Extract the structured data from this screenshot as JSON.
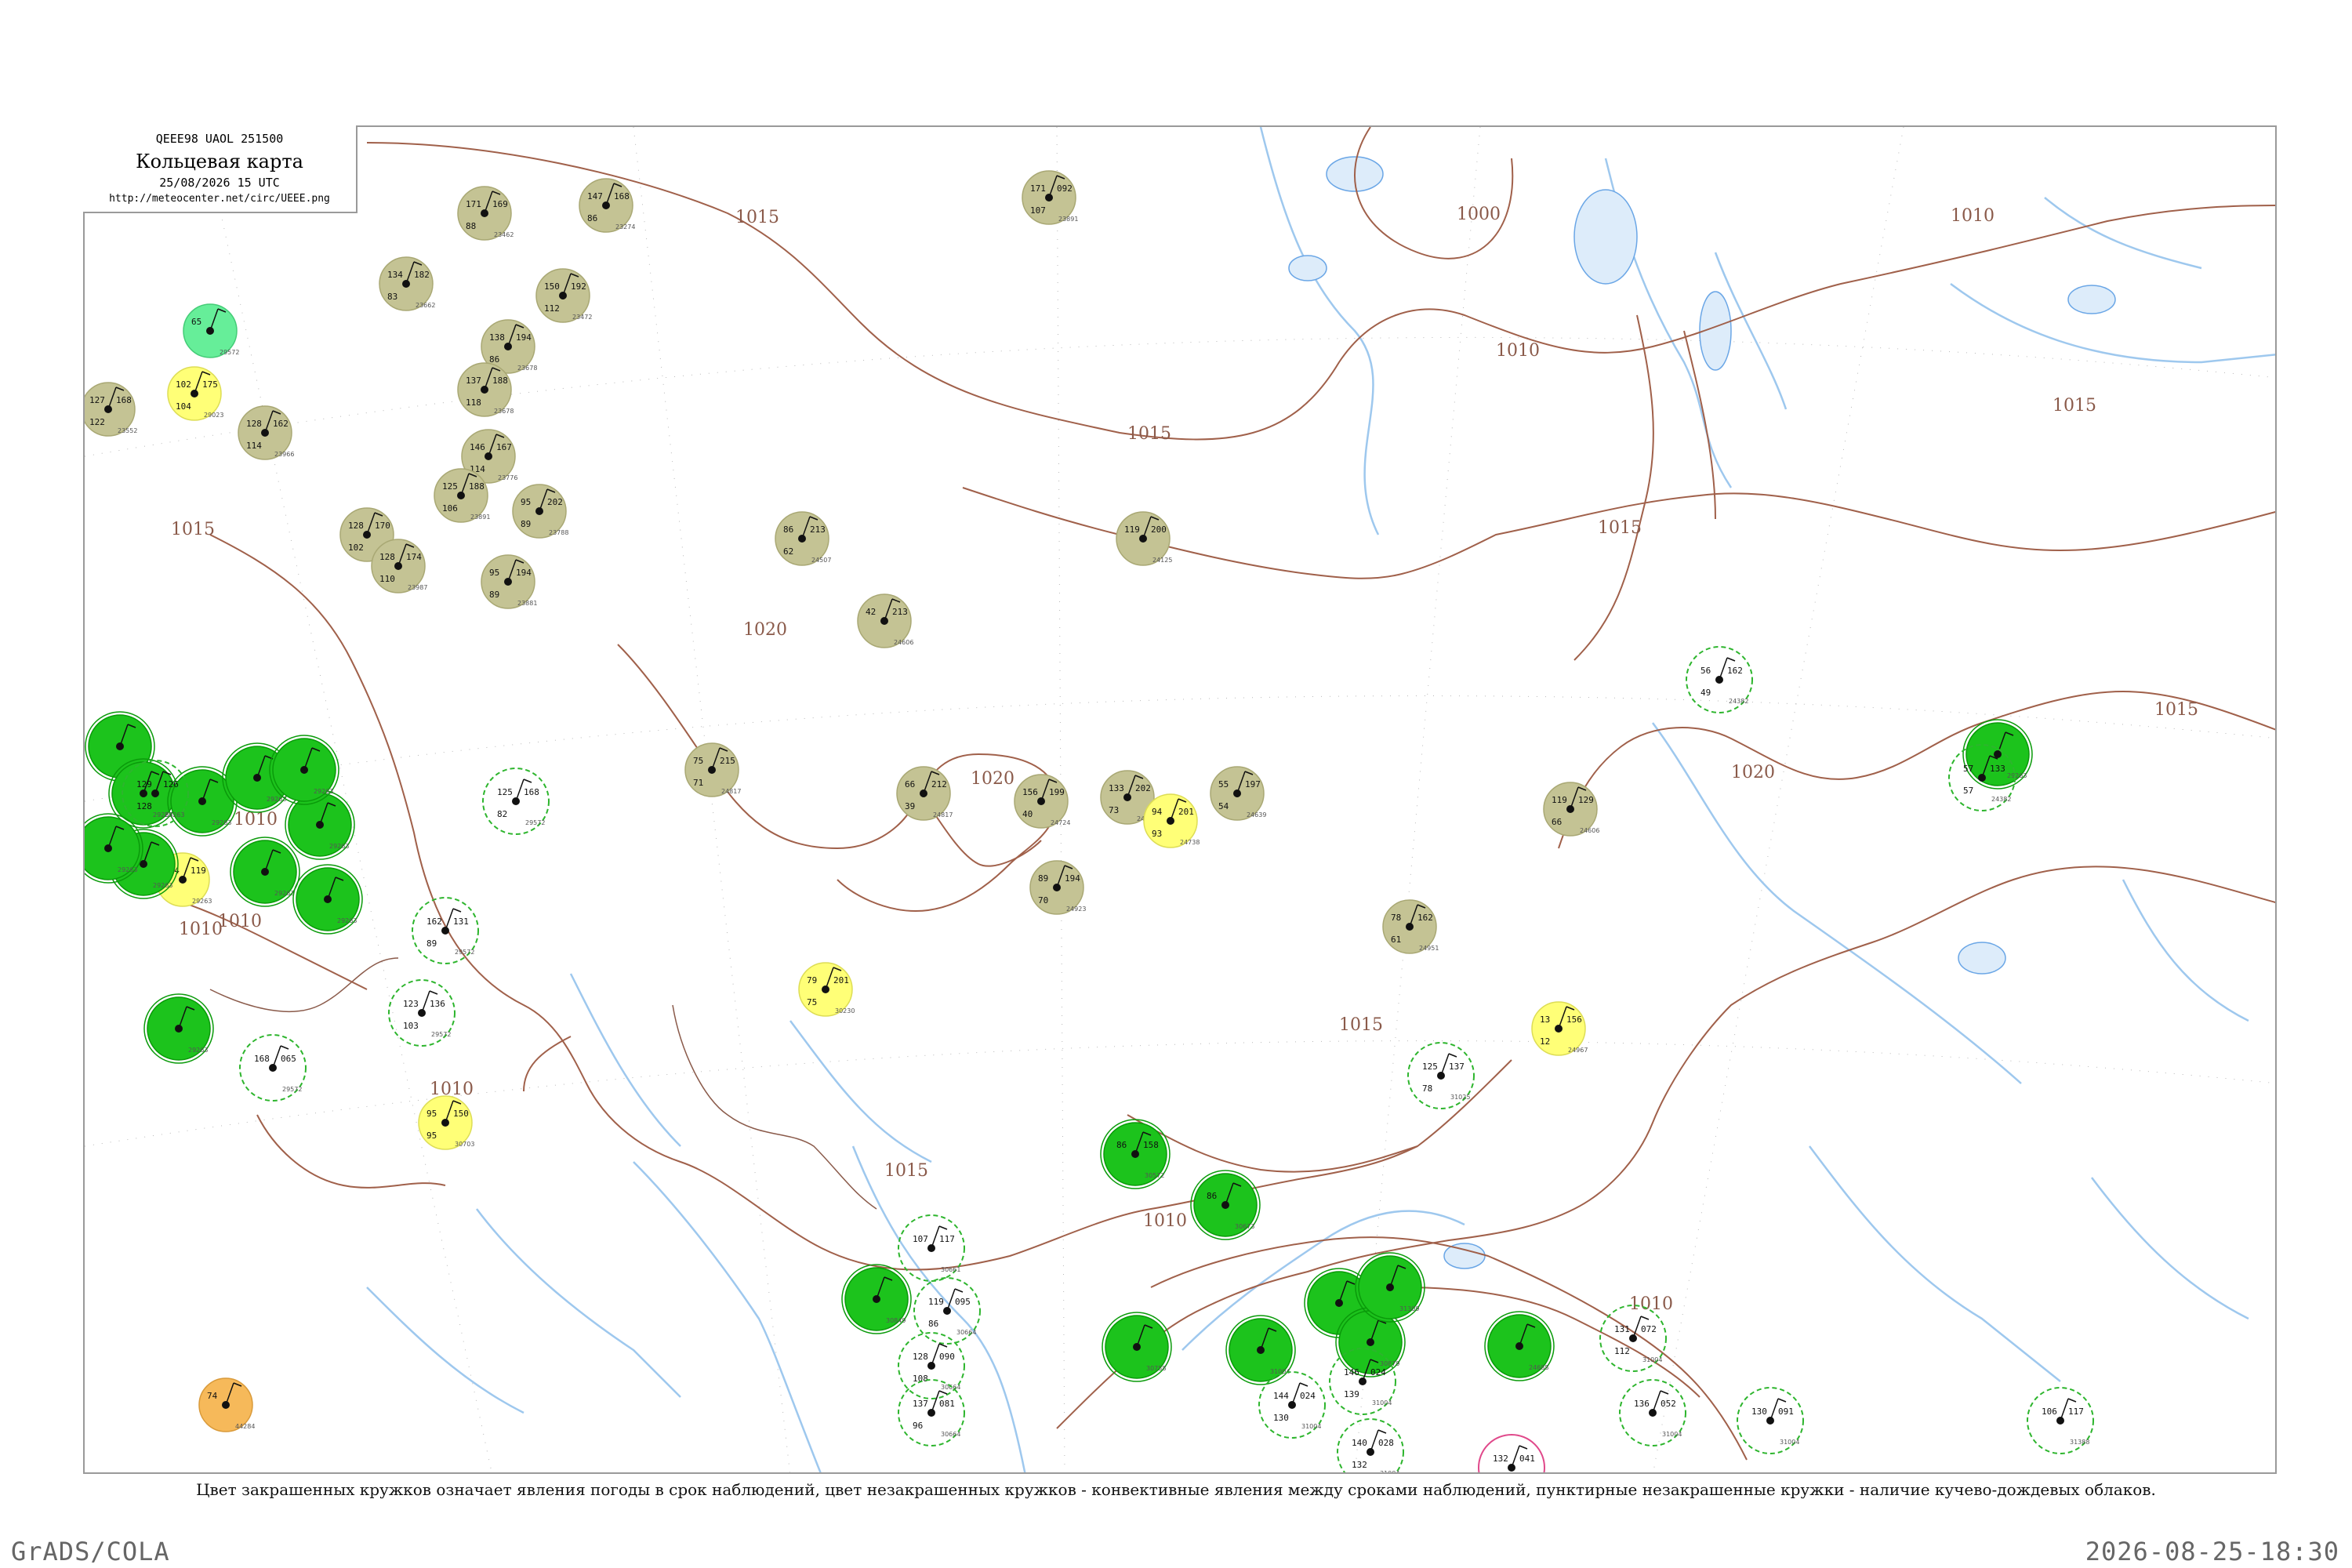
{
  "header": {
    "code_line": "QEEE98  UAOL  251500",
    "title": "Кольцевая карта",
    "datetime": "25/08/2026 15 UTC",
    "url": "http://meteocenter.net/circ/UEEE.png"
  },
  "caption": "Цвет закрашенных кружков означает явления погоды в срок наблюдений, цвет незакрашенных кружков - конвективные явления между сроками наблюдений, пунктирные незакрашенные кружки - наличие кучево-дождевых облаков.",
  "footer": {
    "left": "GrADS/COLA",
    "right": "2026-08-25-18:30"
  },
  "colors": {
    "isobar": "#a0604a",
    "river": "#9ec8ee",
    "lake": "#6aa6e6",
    "fill_olive": "#c4c394",
    "fill_green": "#1cc31c",
    "fill_yellow": "#ffff77",
    "fill_orange": "#f6b95a",
    "fill_mint": "#66ee99",
    "ring_dashed": "#2db52d",
    "ring_pink": "#e0488a"
  },
  "isobar_labels": [
    {
      "id": "iso-1000",
      "text": "1000"
    },
    {
      "id": "iso-1010-a",
      "text": "1010"
    },
    {
      "id": "iso-1010-b",
      "text": "1010"
    },
    {
      "id": "iso-1010-c",
      "text": "1010"
    },
    {
      "id": "iso-1010-d",
      "text": "1010"
    },
    {
      "id": "iso-1010-e",
      "text": "1010"
    },
    {
      "id": "iso-1010-f",
      "text": "1010"
    },
    {
      "id": "iso-1010-g",
      "text": "1010"
    },
    {
      "id": "iso-1010-h",
      "text": "1010"
    },
    {
      "id": "iso-1015-a",
      "text": "1015"
    },
    {
      "id": "iso-1015-b",
      "text": "1015"
    },
    {
      "id": "iso-1015-c",
      "text": "1015"
    },
    {
      "id": "iso-1015-d",
      "text": "1015"
    },
    {
      "id": "iso-1015-e",
      "text": "1015"
    },
    {
      "id": "iso-1015-f",
      "text": "1015"
    },
    {
      "id": "iso-1015-g",
      "text": "1015"
    },
    {
      "id": "iso-1015-h",
      "text": "1015"
    },
    {
      "id": "iso-1020-a",
      "text": "1020"
    },
    {
      "id": "iso-1020-b",
      "text": "1020"
    }
  ],
  "stations": [
    {
      "id": "st1",
      "temp": "171",
      "press": "169",
      "dew": "88",
      "style": "olive",
      "name": "23462"
    },
    {
      "id": "st2",
      "temp": "147",
      "press": "168",
      "dew": "86",
      "style": "olive",
      "name": "23274"
    },
    {
      "id": "st3",
      "temp": "134",
      "press": "182",
      "dew": "83",
      "style": "olive",
      "name": "23662"
    },
    {
      "id": "st4",
      "temp": "150",
      "press": "192",
      "dew": "112",
      "style": "olive",
      "name": "23472"
    },
    {
      "id": "st5",
      "temp": "138",
      "press": "194",
      "dew": "86",
      "style": "olive",
      "name": "23678"
    },
    {
      "id": "st6",
      "temp": "137",
      "press": "188",
      "dew": "118",
      "style": "olive",
      "name": "23678"
    },
    {
      "id": "st7",
      "temp": "146",
      "press": "167",
      "dew": "114",
      "style": "olive",
      "name": "23776"
    },
    {
      "id": "st8",
      "temp": "125",
      "press": "188",
      "dew": "106",
      "style": "olive",
      "name": "23891"
    },
    {
      "id": "st9",
      "temp": "95",
      "press": "202",
      "dew": "89",
      "style": "olive",
      "name": "23788"
    },
    {
      "id": "st10",
      "temp": "128",
      "press": "170",
      "dew": "102",
      "style": "olive",
      "name": "23891"
    },
    {
      "id": "st11",
      "temp": "128",
      "press": "174",
      "dew": "110",
      "style": "olive",
      "name": "23987"
    },
    {
      "id": "st12",
      "temp": "95",
      "press": "194",
      "dew": "89",
      "style": "olive",
      "name": "23881"
    },
    {
      "id": "st13",
      "temp": "127",
      "press": "168",
      "dew": "122",
      "style": "olive",
      "name": "23552"
    },
    {
      "id": "st14",
      "temp": "128",
      "press": "162",
      "dew": "114",
      "style": "olive",
      "name": "23966"
    },
    {
      "id": "st15",
      "temp": "171",
      "press": "092",
      "dew": "107",
      "style": "olive",
      "name": "23891"
    },
    {
      "id": "st16",
      "temp": "86",
      "press": "213",
      "dew": "62",
      "style": "olive",
      "name": "24507"
    },
    {
      "id": "st17",
      "temp": "42",
      "press": "213",
      "dew": "",
      "style": "olive",
      "name": "24606"
    },
    {
      "id": "st18",
      "temp": "75",
      "press": "215",
      "dew": "71",
      "style": "olive",
      "name": "24817"
    },
    {
      "id": "st19",
      "temp": "66",
      "press": "212",
      "dew": "39",
      "style": "olive",
      "name": "24817"
    },
    {
      "id": "st20",
      "temp": "156",
      "press": "199",
      "dew": "40",
      "style": "olive",
      "name": "24724"
    },
    {
      "id": "st21",
      "temp": "133",
      "press": "202",
      "dew": "73",
      "style": "olive",
      "name": "24726"
    },
    {
      "id": "st22",
      "temp": "55",
      "press": "197",
      "dew": "54",
      "style": "olive",
      "name": "24639"
    },
    {
      "id": "st23",
      "temp": "89",
      "press": "194",
      "dew": "70",
      "style": "olive",
      "name": "24923"
    },
    {
      "id": "st24",
      "temp": "119",
      "press": "200",
      "dew": "",
      "style": "olive",
      "name": "24125"
    },
    {
      "id": "st25",
      "temp": "78",
      "press": "162",
      "dew": "61",
      "style": "olive",
      "name": "24951"
    },
    {
      "id": "st26",
      "temp": "119",
      "press": "129",
      "dew": "66",
      "style": "olive",
      "name": "24606"
    },
    {
      "id": "st27",
      "temp": "94",
      "press": "201",
      "dew": "93",
      "style": "yellow",
      "name": "24738"
    },
    {
      "id": "st28",
      "temp": "79",
      "press": "201",
      "dew": "75",
      "style": "yellow",
      "name": "30230"
    },
    {
      "id": "st29",
      "temp": "95",
      "press": "150",
      "dew": "95",
      "style": "yellow",
      "name": "30703"
    },
    {
      "id": "st30",
      "temp": "102",
      "press": "175",
      "dew": "104",
      "style": "yellow",
      "name": "29023"
    },
    {
      "id": "st31",
      "temp": "124",
      "press": "119",
      "dew": "",
      "style": "yellow",
      "name": "29263"
    },
    {
      "id": "st32",
      "temp": "13",
      "press": "156",
      "dew": "12",
      "style": "yellow",
      "name": "24967"
    },
    {
      "id": "st33",
      "temp": "65",
      "press": "",
      "dew": "",
      "style": "mint",
      "name": "29572"
    },
    {
      "id": "st34",
      "temp": "74",
      "press": "",
      "dew": "",
      "style": "orange",
      "name": "44284"
    },
    {
      "id": "st35",
      "temp": "86",
      "press": "158",
      "dew": "",
      "style": "green",
      "name": "30572"
    },
    {
      "id": "st36",
      "temp": "86",
      "press": "",
      "dew": "",
      "style": "green",
      "name": "30673"
    },
    {
      "id": "st37",
      "temp": "",
      "press": "",
      "dew": "",
      "style": "green",
      "name": "30849"
    },
    {
      "id": "st38",
      "temp": "",
      "press": "",
      "dew": "",
      "style": "green",
      "name": "30758"
    },
    {
      "id": "st39",
      "temp": "",
      "press": "",
      "dew": "",
      "style": "green",
      "name": "31004"
    },
    {
      "id": "st40",
      "temp": "",
      "press": "",
      "dew": "",
      "style": "green",
      "name": "30879"
    },
    {
      "id": "st41",
      "temp": "",
      "press": "",
      "dew": "",
      "style": "green",
      "name": "30879"
    },
    {
      "id": "st42",
      "temp": "",
      "press": "",
      "dew": "",
      "style": "green",
      "name": "31309"
    },
    {
      "id": "st43",
      "temp": "",
      "press": "",
      "dew": "",
      "style": "green",
      "name": "24688"
    },
    {
      "id": "st44",
      "temp": "",
      "press": "",
      "dew": "",
      "style": "green",
      "name": "29263"
    },
    {
      "id": "st45",
      "temp": "",
      "press": "",
      "dew": "",
      "style": "green",
      "name": "29263"
    },
    {
      "id": "st46",
      "temp": "",
      "press": "",
      "dew": "",
      "style": "green",
      "name": "29263"
    },
    {
      "id": "st47",
      "temp": "",
      "press": "",
      "dew": "",
      "style": "green",
      "name": "29263"
    },
    {
      "id": "st48",
      "temp": "",
      "press": "",
      "dew": "",
      "style": "green",
      "name": "29263"
    },
    {
      "id": "st49",
      "temp": "",
      "press": "",
      "dew": "",
      "style": "green",
      "name": "29263"
    },
    {
      "id": "st50",
      "temp": "",
      "press": "",
      "dew": "",
      "style": "green",
      "name": "29263"
    },
    {
      "id": "st51",
      "temp": "",
      "press": "",
      "dew": "",
      "style": "green",
      "name": "29263"
    },
    {
      "id": "st52",
      "temp": "",
      "press": "",
      "dew": "",
      "style": "green",
      "name": "29263"
    },
    {
      "id": "st53",
      "temp": "",
      "press": "",
      "dew": "",
      "style": "green",
      "name": "29263"
    },
    {
      "id": "st54",
      "temp": "",
      "press": "",
      "dew": "",
      "style": "green",
      "name": "29263"
    },
    {
      "id": "st55",
      "temp": "",
      "press": "",
      "dew": "",
      "style": "green",
      "name": "29263"
    },
    {
      "id": "st56",
      "temp": "129",
      "press": "126",
      "dew": "128",
      "style": "dashed",
      "name": "29263"
    },
    {
      "id": "st57",
      "temp": "125",
      "press": "168",
      "dew": "82",
      "style": "dashed",
      "name": "29572"
    },
    {
      "id": "st58",
      "temp": "162",
      "press": "131",
      "dew": "89",
      "style": "dashed",
      "name": "29572"
    },
    {
      "id": "st59",
      "temp": "123",
      "press": "136",
      "dew": "103",
      "style": "dashed",
      "name": "29572"
    },
    {
      "id": "st60",
      "temp": "168",
      "press": "065",
      "dew": "",
      "style": "dashed",
      "name": "29572"
    },
    {
      "id": "st61",
      "temp": "107",
      "press": "117",
      "dew": "",
      "style": "dashed",
      "name": "30661"
    },
    {
      "id": "st62",
      "temp": "119",
      "press": "095",
      "dew": "86",
      "style": "dashed",
      "name": "30664"
    },
    {
      "id": "st63",
      "temp": "128",
      "press": "090",
      "dew": "108",
      "style": "dashed",
      "name": "30664"
    },
    {
      "id": "st64",
      "temp": "137",
      "press": "081",
      "dew": "96",
      "style": "dashed",
      "name": "30664"
    },
    {
      "id": "st65",
      "temp": "144",
      "press": "024",
      "dew": "130",
      "style": "dashed",
      "name": "31004"
    },
    {
      "id": "st66",
      "temp": "140",
      "press": "028",
      "dew": "132",
      "style": "dashed",
      "name": "31004"
    },
    {
      "id": "st67",
      "temp": "146",
      "press": "024",
      "dew": "139",
      "style": "dashed",
      "name": "31004"
    },
    {
      "id": "st68",
      "temp": "125",
      "press": "137",
      "dew": "78",
      "style": "dashed",
      "name": "31025"
    },
    {
      "id": "st69",
      "temp": "131",
      "press": "072",
      "dew": "112",
      "style": "dashed",
      "name": "31004"
    },
    {
      "id": "st70",
      "temp": "136",
      "press": "052",
      "dew": "",
      "style": "dashed",
      "name": "31004"
    },
    {
      "id": "st71",
      "temp": "130",
      "press": "091",
      "dew": "",
      "style": "dashed",
      "name": "31004"
    },
    {
      "id": "st72",
      "temp": "106",
      "press": "117",
      "dew": "",
      "style": "dashed",
      "name": "31388"
    },
    {
      "id": "st73",
      "temp": "56",
      "press": "162",
      "dew": "49",
      "style": "dashed",
      "name": "24382"
    },
    {
      "id": "st74",
      "temp": "57",
      "press": "133",
      "dew": "57",
      "style": "dashed",
      "name": "24382"
    },
    {
      "id": "st75",
      "temp": "132",
      "press": "041",
      "dew": "132",
      "style": "pink",
      "name": "31369"
    }
  ]
}
